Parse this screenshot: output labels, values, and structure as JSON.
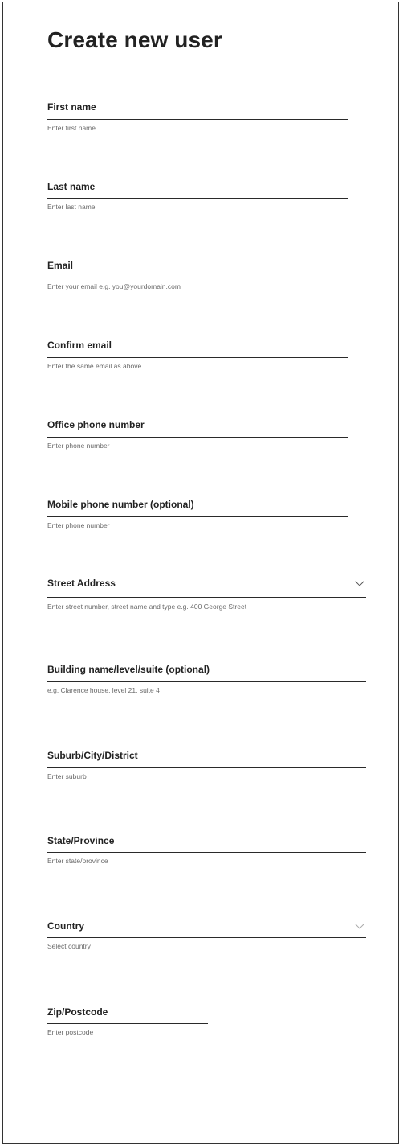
{
  "title": "Create new user",
  "fields": [
    {
      "label": "First name",
      "placeholder": "Enter first name"
    },
    {
      "label": "Last name",
      "placeholder": "Enter last name"
    },
    {
      "label": "Email",
      "placeholder": "Enter your email e.g. you@yourdomain.com"
    },
    {
      "label": "Confirm email",
      "placeholder": "Enter the same email as above"
    },
    {
      "label": "Office phone number",
      "placeholder": "Enter phone number"
    },
    {
      "label": "Mobile phone number (optional)",
      "placeholder": "Enter phone number"
    },
    {
      "label": "Street Address",
      "placeholder": "Enter street number, street name and type e.g. 400 George Street",
      "icon": "chevron-down-icon"
    },
    {
      "label": "Building name/level/suite (optional)",
      "placeholder": "e.g. Clarence house, level 21, suite 4"
    },
    {
      "label": "Suburb/City/District",
      "placeholder": "Enter suburb"
    },
    {
      "label": "State/Province",
      "placeholder": "Enter state/province"
    },
    {
      "label": "Country",
      "placeholder": "Select country",
      "icon": "chevron-down-icon"
    },
    {
      "label": "Zip/Postcode",
      "placeholder": "Enter postcode"
    }
  ]
}
